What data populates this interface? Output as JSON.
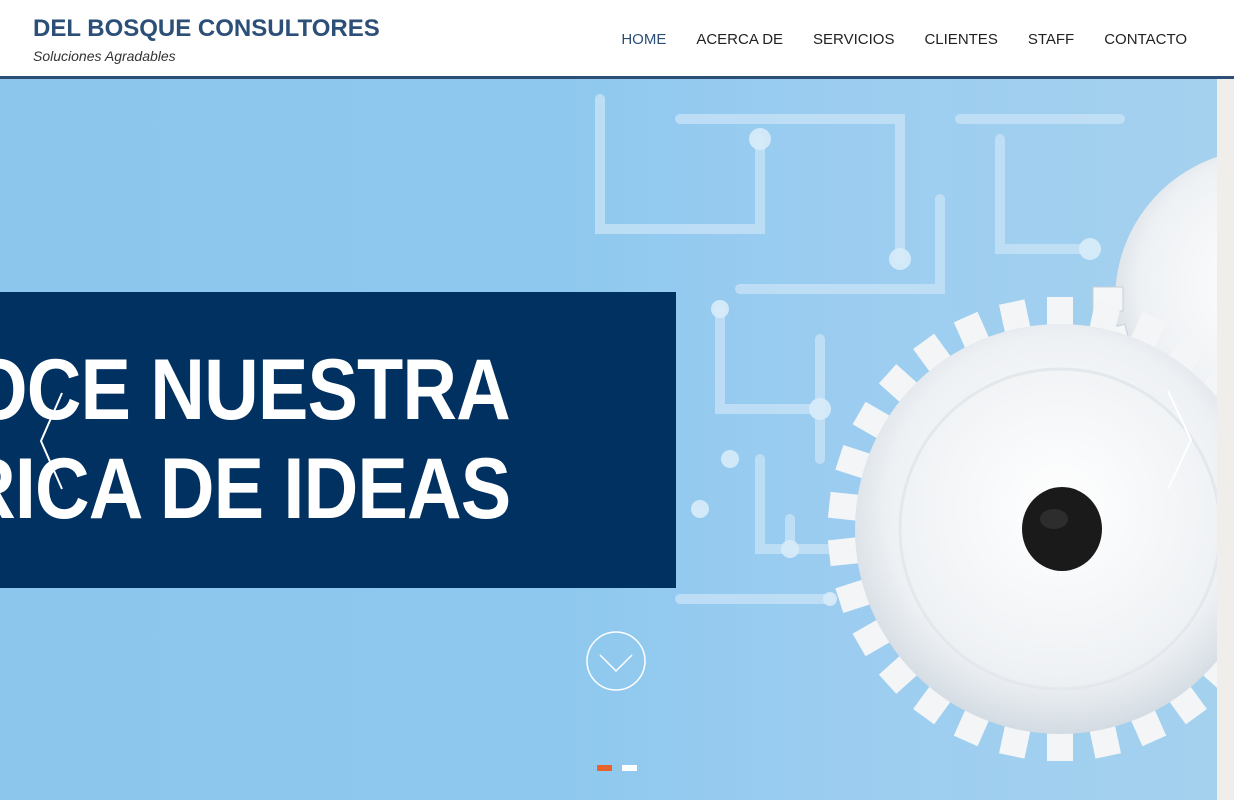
{
  "brand": {
    "title": "DEL BOSQUE CONSULTORES",
    "subtitle": "Soluciones Agradables",
    "color": "#2c4f77"
  },
  "nav": {
    "items": [
      {
        "label": "HOME",
        "active": true
      },
      {
        "label": "ACERCA DE",
        "active": false
      },
      {
        "label": "SERVICIOS",
        "active": false
      },
      {
        "label": "CLIENTES",
        "active": false
      },
      {
        "label": "STAFF",
        "active": false
      },
      {
        "label": "CONTACTO",
        "active": false
      }
    ]
  },
  "hero": {
    "headline_line1": "ONOCE NUESTRA",
    "headline_line2": "ÁBRICA DE IDEAS",
    "box_color": "#003160",
    "background_color": "#8cc6ec",
    "prev_icon": "chevron-left-icon",
    "next_icon": "chevron-right-icon",
    "scroll_icon": "chevron-down-circle-icon",
    "slides_total": 2,
    "active_slide": 1,
    "active_dot_color": "#e8622e"
  }
}
